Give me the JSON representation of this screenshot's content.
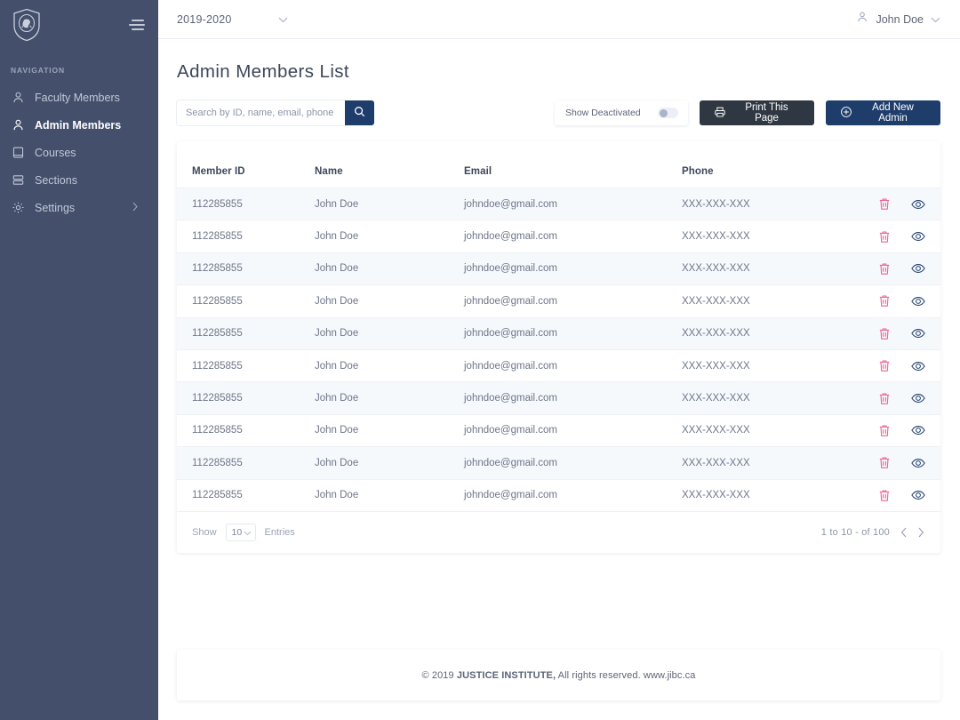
{
  "sidebar": {
    "logo": "shield-crest-logo",
    "menu_toggle": "menu-toggle-icon",
    "nav_label": "NAVIGATION",
    "items": [
      {
        "label": "Faculty Members",
        "icon": "user-icon",
        "active": false,
        "chevron": false
      },
      {
        "label": "Admin Members",
        "icon": "user-icon",
        "active": true,
        "chevron": false
      },
      {
        "label": "Courses",
        "icon": "book-icon",
        "active": false,
        "chevron": false
      },
      {
        "label": "Sections",
        "icon": "list-icon",
        "active": false,
        "chevron": false
      },
      {
        "label": "Settings",
        "icon": "gear-icon",
        "active": false,
        "chevron": true
      }
    ]
  },
  "topbar": {
    "year": "2019-2020",
    "year_chevron": "chevron-down-icon",
    "user_icon": "user-icon",
    "user_name": "John Doe",
    "user_chevron": "chevron-down-icon"
  },
  "page": {
    "title": "Admin Members List"
  },
  "search": {
    "placeholder": "Search by ID, name, email, phone",
    "value": "",
    "button_icon": "search-icon"
  },
  "toolbar": {
    "show_deactivated_label": "Show Deactivated",
    "show_deactivated_on": false,
    "print_label": "Print This Page",
    "print_icon": "printer-icon",
    "add_label": "Add New Admin",
    "add_icon": "plus-circle-icon"
  },
  "table": {
    "columns": [
      "Member ID",
      "Name",
      "Email",
      "Phone"
    ],
    "row_actions": {
      "delete_icon": "trash-icon",
      "view_icon": "eye-icon"
    },
    "rows": [
      {
        "member_id": "112285855",
        "name": "John Doe",
        "email": "johndoe@gmail.com",
        "phone": "XXX-XXX-XXX"
      },
      {
        "member_id": "112285855",
        "name": "John Doe",
        "email": "johndoe@gmail.com",
        "phone": "XXX-XXX-XXX"
      },
      {
        "member_id": "112285855",
        "name": "John Doe",
        "email": "johndoe@gmail.com",
        "phone": "XXX-XXX-XXX"
      },
      {
        "member_id": "112285855",
        "name": "John Doe",
        "email": "johndoe@gmail.com",
        "phone": "XXX-XXX-XXX"
      },
      {
        "member_id": "112285855",
        "name": "John Doe",
        "email": "johndoe@gmail.com",
        "phone": "XXX-XXX-XXX"
      },
      {
        "member_id": "112285855",
        "name": "John Doe",
        "email": "johndoe@gmail.com",
        "phone": "XXX-XXX-XXX"
      },
      {
        "member_id": "112285855",
        "name": "John Doe",
        "email": "johndoe@gmail.com",
        "phone": "XXX-XXX-XXX"
      },
      {
        "member_id": "112285855",
        "name": "John Doe",
        "email": "johndoe@gmail.com",
        "phone": "XXX-XXX-XXX"
      },
      {
        "member_id": "112285855",
        "name": "John Doe",
        "email": "johndoe@gmail.com",
        "phone": "XXX-XXX-XXX"
      },
      {
        "member_id": "112285855",
        "name": "John Doe",
        "email": "johndoe@gmail.com",
        "phone": "XXX-XXX-XXX"
      }
    ]
  },
  "pagination": {
    "show_label": "Show",
    "entries_value": "10",
    "entries_label": "Entries",
    "entries_chevron": "chevron-down-icon",
    "range_text": "1 to 10 - of  100",
    "prev_icon": "chevron-left-icon",
    "next_icon": "chevron-right-icon"
  },
  "footer": {
    "copyright_prefix": "© 2019 ",
    "org": "JUSTICE INSTITUTE,",
    "rights": " All rights reserved. www.jibc.ca"
  },
  "colors": {
    "sidebar_bg": "#434f6b",
    "primary": "#1e3d6b",
    "dark_button": "#2f3742",
    "delete": "#f06292",
    "view": "#1e3d6b",
    "row_alt": "#f6f9fc",
    "text_muted": "#6d7689"
  }
}
